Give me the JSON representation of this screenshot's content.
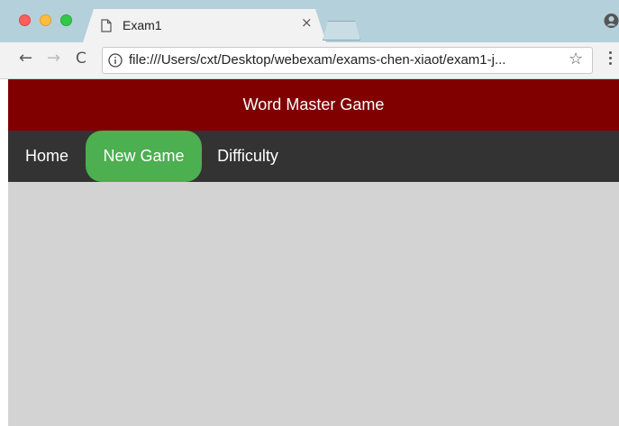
{
  "browser": {
    "tab": {
      "title": "Exam1",
      "close_glyph": "×"
    },
    "toolbar": {
      "back_glyph": "←",
      "forward_glyph": "→",
      "reload_glyph": "C",
      "url": "file:///Users/cxt/Desktop/webexam/exams-chen-xiaot/exam1-j...",
      "star_glyph": "☆"
    },
    "icons": {
      "page": "page-icon",
      "info": "info-icon",
      "profile": "profile-icon",
      "menu": "menu-icon"
    }
  },
  "page": {
    "banner_title": "Word Master Game",
    "nav": [
      {
        "label": "Home",
        "active": false
      },
      {
        "label": "New Game",
        "active": true
      },
      {
        "label": "Difficulty",
        "active": false
      }
    ],
    "colors": {
      "banner": "#800000",
      "navbar": "#333333",
      "active_nav": "#4caf50",
      "background": "#d3d3d3"
    }
  }
}
